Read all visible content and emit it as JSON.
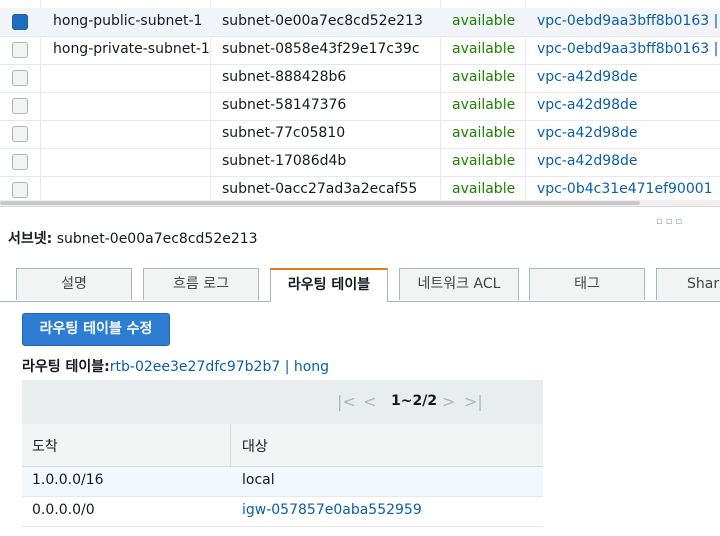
{
  "subnets": {
    "rows": [
      {
        "name": "hong-public-subnet-1",
        "id": "subnet-0e00a7ec8cd52e213",
        "state": "available",
        "vpc": "vpc-0ebd9aa3bff8b0163 |",
        "selected": true
      },
      {
        "name": "hong-private-subnet-1",
        "id": "subnet-0858e43f29e17c39c",
        "state": "available",
        "vpc": "vpc-0ebd9aa3bff8b0163 |",
        "selected": false
      },
      {
        "name": "",
        "id": "subnet-888428b6",
        "state": "available",
        "vpc": "vpc-a42d98de",
        "selected": false
      },
      {
        "name": "",
        "id": "subnet-58147376",
        "state": "available",
        "vpc": "vpc-a42d98de",
        "selected": false
      },
      {
        "name": "",
        "id": "subnet-77c05810",
        "state": "available",
        "vpc": "vpc-a42d98de",
        "selected": false
      },
      {
        "name": "",
        "id": "subnet-17086d4b",
        "state": "available",
        "vpc": "vpc-a42d98de",
        "selected": false
      },
      {
        "name": "",
        "id": "subnet-0acc27ad3a2ecaf55",
        "state": "available",
        "vpc": "vpc-0b4c31e471ef90001",
        "selected": false
      }
    ]
  },
  "detail": {
    "label": "서브넷:",
    "value": "subnet-0e00a7ec8cd52e213"
  },
  "tabs": [
    "설명",
    "흐름 로그",
    "라우팅 테이블",
    "네트워크 ACL",
    "태그",
    "Shari"
  ],
  "active_tab": "라우팅 테이블",
  "edit_button": "라우팅 테이블 수정",
  "route_table": {
    "label": "라우팅 테이블:",
    "link": "rtb-02ee3e27dfc97b2b7 | hong",
    "pager": "1~2/2",
    "columns": [
      "도착",
      "대상"
    ],
    "rows": [
      {
        "destination": "1.0.0.0/16",
        "target": "local",
        "target_link": false
      },
      {
        "destination": "0.0.0.0/0",
        "target": "igw-057857e0aba552959",
        "target_link": true
      }
    ]
  },
  "colors": {
    "accent": "#2d7dd2",
    "status_available": "#1d8102",
    "link": "#0b5ea8",
    "active_tab_border": "#e07b1a"
  }
}
